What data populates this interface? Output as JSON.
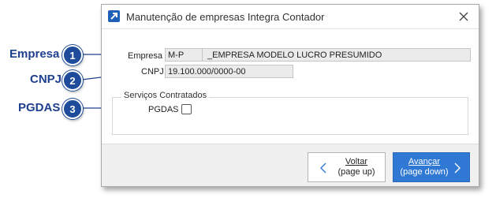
{
  "callouts": [
    {
      "label": "Empresa",
      "number": "1"
    },
    {
      "label": "CNPJ",
      "number": "2"
    },
    {
      "label": "PGDAS",
      "number": "3"
    }
  ],
  "window": {
    "title": "Manutenção de empresas Integra Contador"
  },
  "form": {
    "empresa_label": "Empresa",
    "empresa_code": "M-P",
    "empresa_name": "_EMPRESA MODELO LUCRO PRESUMIDO",
    "cnpj_label": "CNPJ",
    "cnpj_value": "19.100.000/0000-00",
    "services_group_title": "Serviços Contratados",
    "pgdas_label": "PGDAS",
    "pgdas_checked": false
  },
  "buttons": {
    "voltar_line1": "Voltar",
    "voltar_line2": "(page up)",
    "avancar_line1": "Avançar",
    "avancar_line2": "(page down)"
  },
  "colors": {
    "accent": "#2f78d4",
    "callout": "#1f4c9a"
  }
}
